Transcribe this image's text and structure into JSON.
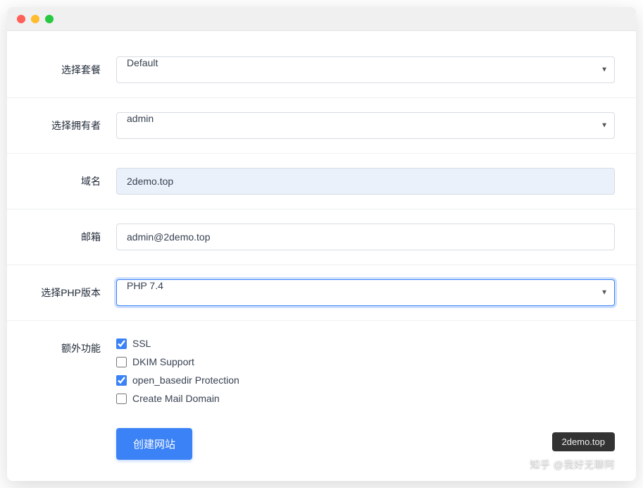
{
  "form": {
    "package_label": "选择套餐",
    "package_value": "Default",
    "owner_label": "选择拥有者",
    "owner_value": "admin",
    "domain_label": "域名",
    "domain_value": "2demo.top",
    "email_label": "邮箱",
    "email_value": "admin@2demo.top",
    "php_label": "选择PHP版本",
    "php_value": "PHP 7.4",
    "extra_label": "额外功能",
    "extras": {
      "ssl_label": "SSL",
      "ssl_checked": true,
      "dkim_label": "DKIM Support",
      "dkim_checked": false,
      "openbasedir_label": "open_basedir Protection",
      "openbasedir_checked": true,
      "maildomain_label": "Create Mail Domain",
      "maildomain_checked": false
    },
    "submit_label": "创建网站"
  },
  "badge_text": "2demo.top",
  "watermark_text": "知乎 @我好无聊阿"
}
